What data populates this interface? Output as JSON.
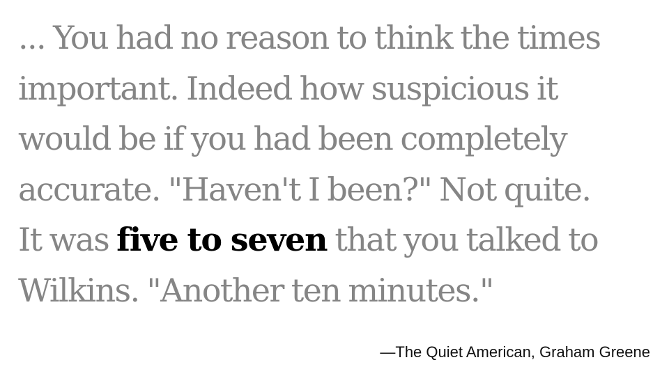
{
  "quote": {
    "lines": [
      {
        "text": "... You had no reason to think the times"
      },
      {
        "text": "important. Indeed how suspicious it"
      },
      {
        "text": "would be if you had been completely"
      },
      {
        "text": "accurate. \"Haven't I been?\" Not quite."
      },
      {
        "before": "It was ",
        "highlight": "five to seven",
        "after": " that you talked to"
      },
      {
        "text": "Wilkins. \"Another ten minutes.\""
      }
    ]
  },
  "attribution": "—The Quiet American, Graham Greene",
  "colors": {
    "quote_text": "#858585",
    "highlight_text": "#000000",
    "attribution_text": "#111111",
    "background": "#ffffff"
  }
}
